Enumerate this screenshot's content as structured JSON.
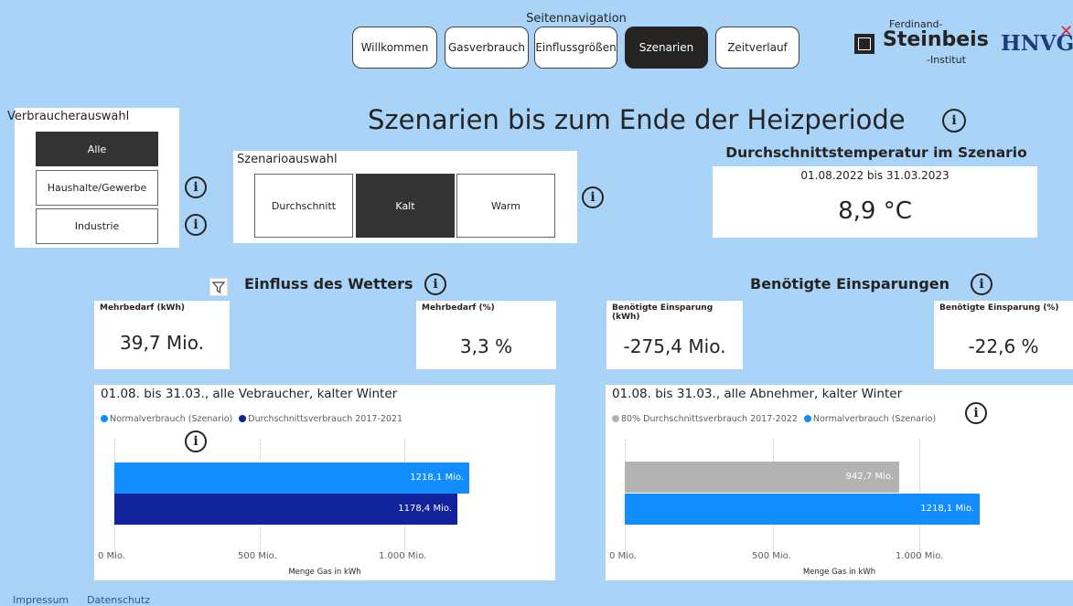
{
  "nav": {
    "title": "Seitennavigation",
    "buttons": [
      "Willkommen",
      "Gasverbrauch",
      "Einflussgrößen",
      "Szenarien",
      "Zeitverlauf"
    ],
    "active": "Szenarien"
  },
  "logos": {
    "steinbeis_top": "Ferdinand-",
    "steinbeis_main": "Steinbeis",
    "steinbeis_bottom": "-Institut",
    "hnvg": "HNVG"
  },
  "page": {
    "title": "Szenarien bis zum Ende der Heizperiode"
  },
  "verbraucher": {
    "title": "Verbraucherauswahl",
    "options": [
      "Alle",
      "Haushalte/Gewerbe",
      "Industrie"
    ],
    "selected": "Alle"
  },
  "szenario": {
    "title": "Szenarioauswahl",
    "options": [
      "Durchschnitt",
      "Kalt",
      "Warm"
    ],
    "selected": "Kalt"
  },
  "temperature": {
    "title": "Durchschnittstemperatur im Szenario",
    "range": "01.08.2022 bis 31.03.2023",
    "value": "8,9 °C"
  },
  "wetter": {
    "title": "Einfluss des Wetters",
    "kpi1_label": "Mehrbedarf (kWh)",
    "kpi1_value": "39,7 Mio.",
    "kpi2_label": "Mehrbedarf (%)",
    "kpi2_value": "3,3 %"
  },
  "einsparungen": {
    "title": "Benötigte Einsparungen",
    "kpi1_label": "Benötigte Einsparung (kWh)",
    "kpi1_value": "-275,4 Mio.",
    "kpi2_label": "Benötigte Einsparung (%)",
    "kpi2_value": "-22,6 %"
  },
  "chart_data": [
    {
      "type": "bar",
      "orientation": "horizontal",
      "title": "01.08. bis 31.03., alle Vebraucher, kalter Winter",
      "xlabel": "Menge Gas in kWh",
      "xlim": [
        0,
        1200
      ],
      "xticks": [
        "0 Mio.",
        "500 Mio.",
        "1.000 Mio."
      ],
      "grid": true,
      "legend_position": "top-left",
      "series": [
        {
          "name": "Normalverbrauch (Szenario)",
          "value": 1218.1,
          "label": "1218,1 Mio.",
          "color": "#118dff"
        },
        {
          "name": "Durchschnittsverbrauch 2017-2021",
          "value": 1178.4,
          "label": "1178,4 Mio.",
          "color": "#12239e"
        }
      ]
    },
    {
      "type": "bar",
      "orientation": "horizontal",
      "title": "01.08. bis 31.03., alle Abnehmer, kalter Winter",
      "xlabel": "Menge Gas in kWh",
      "xlim": [
        0,
        1200
      ],
      "xticks": [
        "0 Mio.",
        "500 Mio.",
        "1.000 Mio."
      ],
      "grid": true,
      "legend_position": "top-left",
      "series": [
        {
          "name": "80% Durchschnittsverbrauch 2017-2022",
          "value": 942.7,
          "label": "942,7 Mio.",
          "color": "#b3b3b3"
        },
        {
          "name": "Normalverbrauch (Szenario)",
          "value": 1218.1,
          "label": "1218,1 Mio.",
          "color": "#118dff"
        }
      ]
    }
  ],
  "footer": {
    "links": [
      "Impressum",
      "Datenschutz"
    ]
  },
  "icons": {
    "info": "info-icon",
    "filter": "filter-icon"
  }
}
